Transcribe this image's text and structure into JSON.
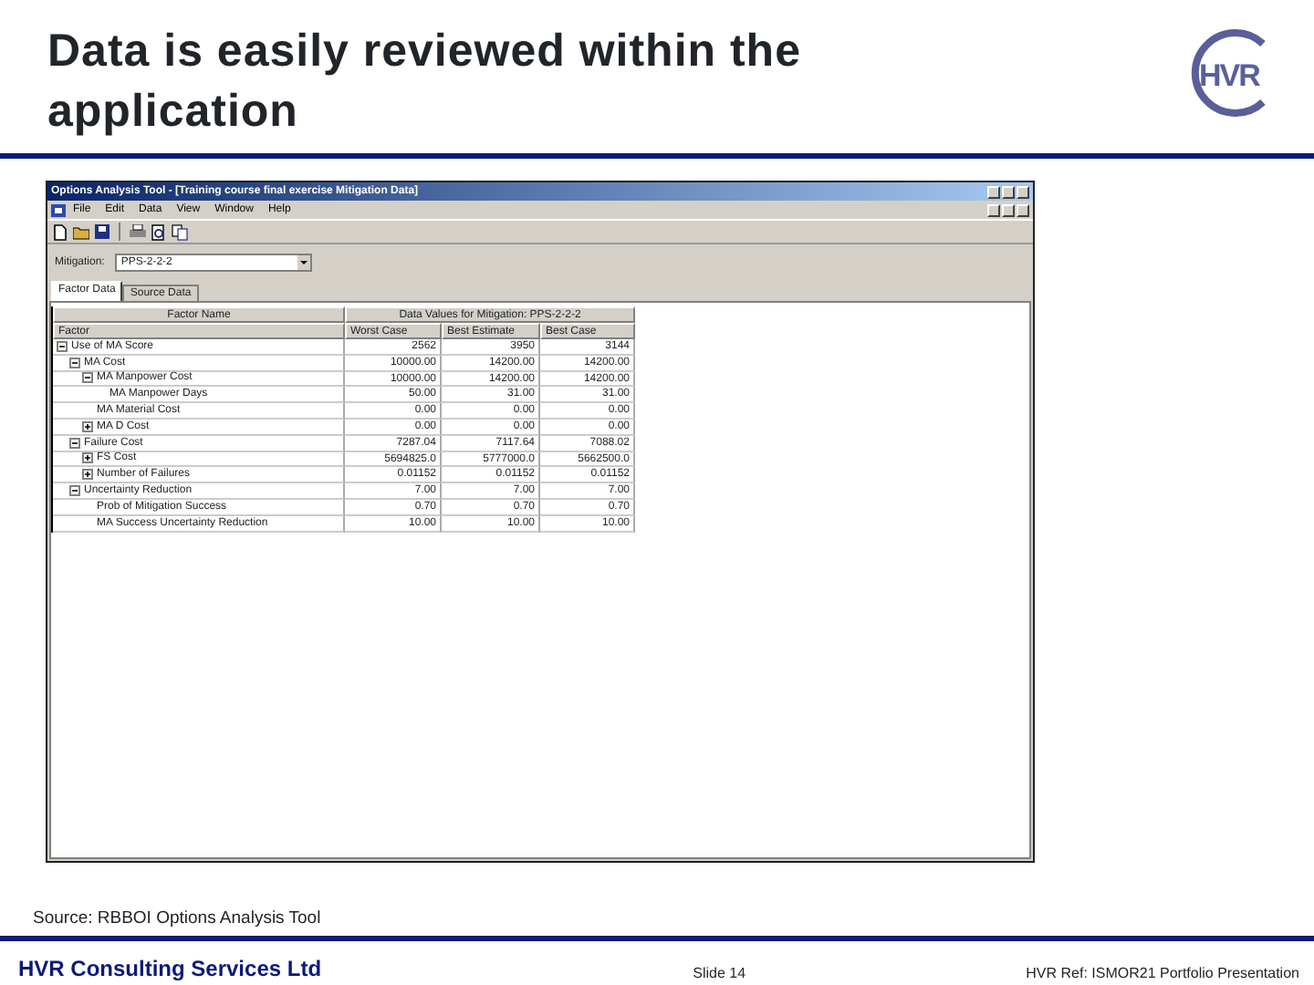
{
  "slide": {
    "title": "Data is easily reviewed within the application",
    "logo": "HVR",
    "source": "Source: RBBOI Options Analysis Tool",
    "company": "HVR Consulting Services Ltd",
    "slide_number": "Slide 14",
    "reference": "HVR Ref: ISMOR21 Portfolio Presentation"
  },
  "app": {
    "window_title": "Options Analysis Tool - [Training course final exercise Mitigation Data]",
    "menu": [
      "File",
      "Edit",
      "Data",
      "View",
      "Window",
      "Help"
    ],
    "mitigation": {
      "label": "Mitigation:",
      "value": "PPS-2-2-2"
    },
    "tabs": [
      {
        "label": "Factor Data",
        "selected": true
      },
      {
        "label": "Source Data",
        "selected": false
      }
    ],
    "table": {
      "header_groups": [
        "Factor Name",
        "Data Values for Mitigation: PPS-2-2-2"
      ],
      "columns": [
        "Factor",
        "Worst Case",
        "Best Estimate",
        "Best Case"
      ],
      "rows": [
        {
          "name": "Use of MA Score",
          "values": [
            "2562",
            "3950",
            "3144"
          ],
          "expanded": true,
          "children": [
            {
              "name": "MA Cost",
              "values": [
                "10000.00",
                "14200.00",
                "14200.00"
              ],
              "expanded": true,
              "children": [
                {
                  "name": "MA Manpower Cost",
                  "values": [
                    "10000.00",
                    "14200.00",
                    "14200.00"
                  ],
                  "expanded": true,
                  "children": [
                    {
                      "name": "MA Manpower Days",
                      "values": [
                        "50.00",
                        "31.00",
                        "31.00"
                      ]
                    }
                  ]
                },
                {
                  "name": "MA Material Cost",
                  "values": [
                    "0.00",
                    "0.00",
                    "0.00"
                  ]
                },
                {
                  "name": "MA D Cost",
                  "values": [
                    "0.00",
                    "0.00",
                    "0.00"
                  ],
                  "expanded": false
                }
              ]
            },
            {
              "name": "Failure Cost",
              "values": [
                "7287.04",
                "7117.64",
                "7088.02"
              ],
              "expanded": true,
              "children": [
                {
                  "name": "FS Cost",
                  "values": [
                    "5694825.0",
                    "5777000.0",
                    "5662500.0"
                  ],
                  "expanded": false
                },
                {
                  "name": "Number of Failures",
                  "values": [
                    "0.01152",
                    "0.01152",
                    "0.01152"
                  ],
                  "expanded": false
                }
              ]
            },
            {
              "name": "Uncertainty Reduction",
              "values": [
                "7.00",
                "7.00",
                "7.00"
              ],
              "expanded": true,
              "children": [
                {
                  "name": "Prob of Mitigation Success",
                  "values": [
                    "0.70",
                    "0.70",
                    "0.70"
                  ]
                },
                {
                  "name": "MA Success Uncertainty Reduction",
                  "values": [
                    "10.00",
                    "10.00",
                    "10.00"
                  ]
                }
              ]
            }
          ]
        }
      ]
    }
  }
}
